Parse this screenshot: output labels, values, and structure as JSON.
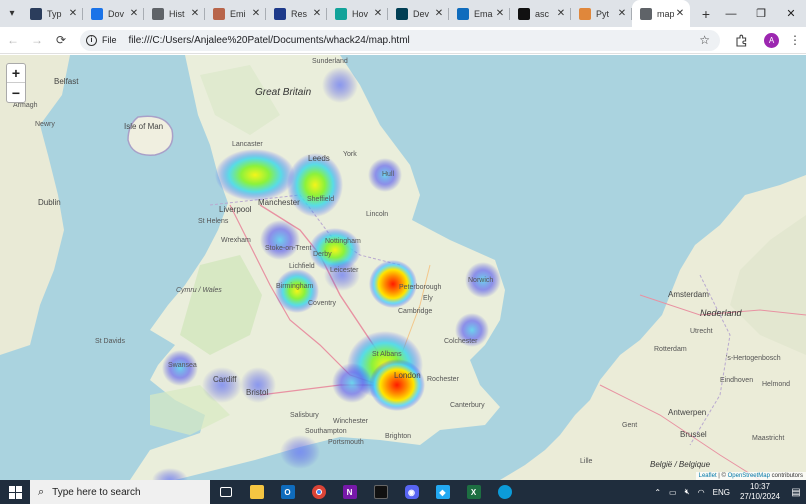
{
  "browser": {
    "tabs": [
      {
        "label": "Typ",
        "icon": "typing-site-icon",
        "color": "#2b3d5c"
      },
      {
        "label": "Dov",
        "icon": "download-icon",
        "color": "#1a73e8"
      },
      {
        "label": "Hist",
        "icon": "history-icon",
        "color": "#5f6368"
      },
      {
        "label": "Emi",
        "icon": "email-site-icon",
        "color": "#b8654a"
      },
      {
        "label": "Res",
        "icon": "resource-site-icon",
        "color": "#1e3a8a"
      },
      {
        "label": "Hov",
        "icon": "hover-site-icon",
        "color": "#12a39a"
      },
      {
        "label": "Dev",
        "icon": "devpost-icon",
        "color": "#003e54"
      },
      {
        "label": "Ema",
        "icon": "outlook-icon",
        "color": "#0f6cbd"
      },
      {
        "label": "asc",
        "icon": "github-icon",
        "color": "#111111"
      },
      {
        "label": "Pyt",
        "icon": "python-site-icon",
        "color": "#e0873b"
      },
      {
        "label": "map",
        "icon": "globe-icon",
        "color": "#5f6368",
        "active": true
      }
    ],
    "url": "file:///C:/Users/Anjalee%20Patel/Documents/whack24/map.html",
    "chip_label": "File",
    "profile_initial": "A"
  },
  "map": {
    "zoom_in": "+",
    "zoom_out": "−",
    "attribution": {
      "leaflet": "Leaflet",
      "sep": " | © ",
      "osm": "OpenStreetMap",
      "rest": " contributors"
    },
    "labels": {
      "great_britain": "Great Britain",
      "sunderland": "Sunderland",
      "belfast": "Belfast",
      "armagh": "Armagh",
      "newry": "Newry",
      "isle_of_man": "Isle of Man",
      "dublin": "Dublin",
      "lancaster": "Lancaster",
      "leeds": "Leeds",
      "york": "York",
      "hull": "Hull",
      "manchester": "Manchester",
      "sheffield": "Sheffield",
      "liverpool": "Liverpool",
      "st_helens": "St Helens",
      "lincoln": "Lincoln",
      "wrexham": "Wrexham",
      "stoke": "Stoke-on-Trent",
      "nottingham": "Nottingham",
      "derby": "Derby",
      "lichfield": "Lichfield",
      "leicester": "Leicester",
      "peterborough": "Peterborough",
      "ely": "Ely",
      "norwich": "Norwich",
      "cymru": "Cymru / Wales",
      "birmingham": "Birmingham",
      "coventry": "Coventry",
      "cambridge": "Cambridge",
      "st_davids": "St Davids",
      "st_albans": "St Albans",
      "colchester": "Colchester",
      "swansea": "Swansea",
      "cardiff": "Cardiff",
      "bristol": "Bristol",
      "london": "London",
      "rochester": "Rochester",
      "canterbury": "Canterbury",
      "salisbury": "Salisbury",
      "winchester": "Winchester",
      "southampton": "Southampton",
      "portsmouth": "Portsmouth",
      "brighton": "Brighton",
      "amsterdam": "Amsterdam",
      "utrecht": "Utrecht",
      "nederland": "Nederland",
      "rotterdam": "Rotterdam",
      "antwerpen": "Antwerpen",
      "brussel": "Brussel",
      "gent": "Gent",
      "belgie": "België / Belgique",
      "lille": "Lille",
      "eindhoven": "Eindhoven",
      "helmond": "Helmond",
      "hertogenbosch": "'s-Hertogenbosch",
      "maastricht": "Maastricht"
    }
  },
  "taskbar": {
    "search_placeholder": "Type here to search",
    "language": "ENG",
    "time": "10:37",
    "date": "27/10/2024"
  }
}
